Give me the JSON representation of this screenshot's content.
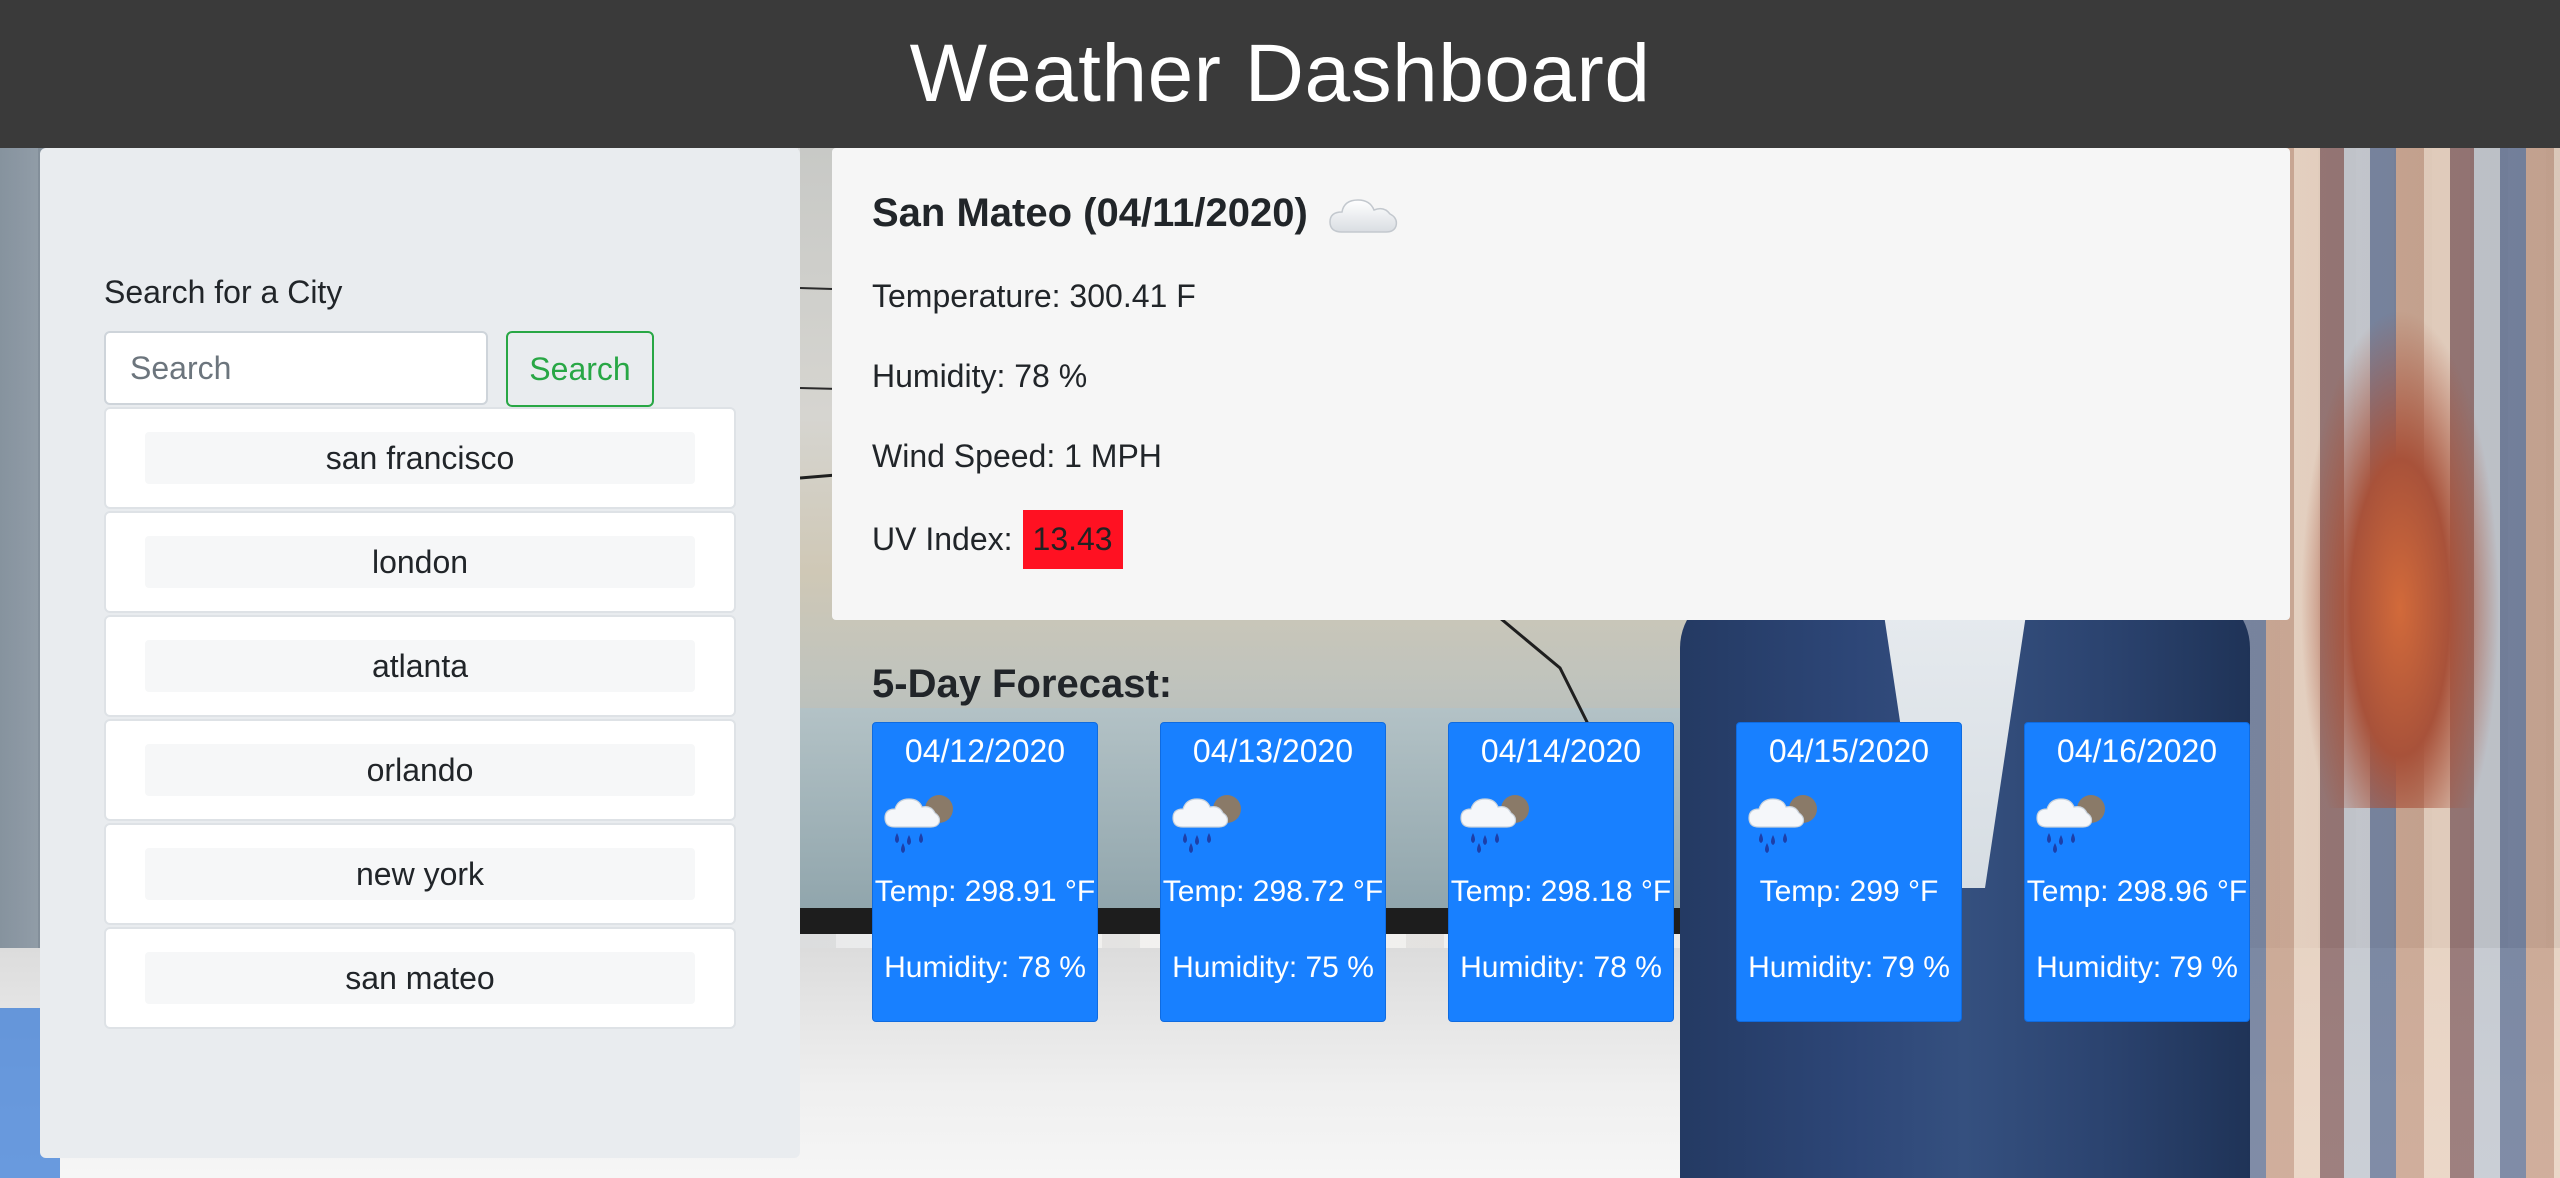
{
  "header": {
    "title": "Weather Dashboard"
  },
  "sidebar": {
    "heading": "Search for a City",
    "search_placeholder": "Search",
    "search_button": "Search",
    "cities": [
      {
        "label": "san francisco"
      },
      {
        "label": "london"
      },
      {
        "label": "atlanta"
      },
      {
        "label": "orlando"
      },
      {
        "label": "new york"
      },
      {
        "label": "san mateo"
      }
    ]
  },
  "current": {
    "title": "San Mateo (04/11/2020)",
    "icon": "cloud-icon",
    "temperature": "Temperature: 300.41 F",
    "humidity": "Humidity: 78 %",
    "wind": "Wind Speed: 1 MPH",
    "uv_label": "UV Index:",
    "uv_value": "13.43",
    "uv_color": "#ff1122"
  },
  "forecast": {
    "heading": "5-Day Forecast:",
    "days": [
      {
        "date": "04/12/2020",
        "icon": "rain-cloud-icon",
        "temp": "Temp: 298.91 °F",
        "humidity": "Humidity: 78 %"
      },
      {
        "date": "04/13/2020",
        "icon": "rain-cloud-icon",
        "temp": "Temp: 298.72 °F",
        "humidity": "Humidity: 75 %"
      },
      {
        "date": "04/14/2020",
        "icon": "rain-cloud-icon",
        "temp": "Temp: 298.18 °F",
        "humidity": "Humidity: 78 %"
      },
      {
        "date": "04/15/2020",
        "icon": "rain-cloud-icon",
        "temp": "Temp: 299 °F",
        "humidity": "Humidity: 79 %"
      },
      {
        "date": "04/16/2020",
        "icon": "rain-cloud-icon",
        "temp": "Temp: 298.96 °F",
        "humidity": "Humidity: 79 %"
      }
    ],
    "card_color": "#1880ff"
  }
}
